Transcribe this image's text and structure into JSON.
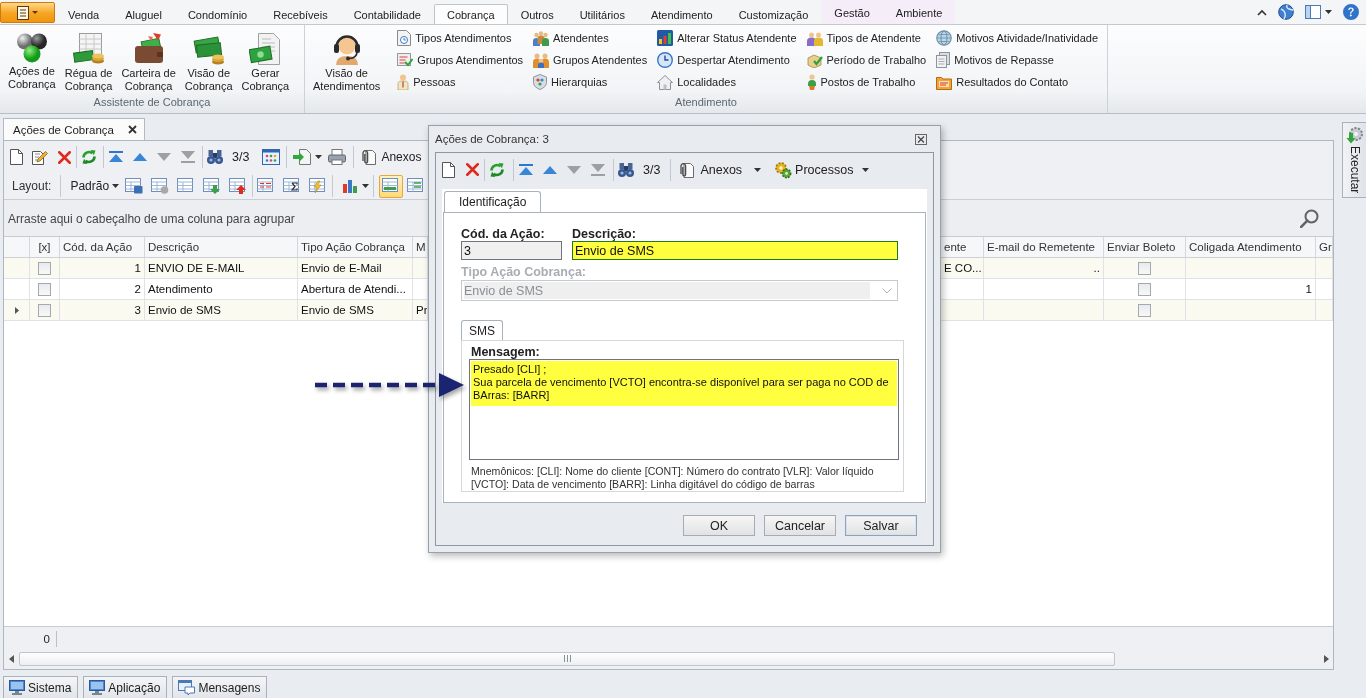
{
  "ribbon": {
    "tabs": [
      {
        "label": "Venda",
        "selected": false,
        "kind": "standard"
      },
      {
        "label": "Aluguel",
        "selected": false,
        "kind": "standard"
      },
      {
        "label": "Condomínio",
        "selected": false,
        "kind": "standard"
      },
      {
        "label": "Recebíveis",
        "selected": false,
        "kind": "standard"
      },
      {
        "label": "Contabilidade",
        "selected": false,
        "kind": "standard"
      },
      {
        "label": "Cobrança",
        "selected": true,
        "kind": "standard"
      },
      {
        "label": "Outros",
        "selected": false,
        "kind": "standard"
      },
      {
        "label": "Utilitários",
        "selected": false,
        "kind": "standard"
      },
      {
        "label": "Atendimento",
        "selected": false,
        "kind": "standard"
      },
      {
        "label": "Customização",
        "selected": false,
        "kind": "standard"
      },
      {
        "label": "Gestão",
        "selected": false,
        "kind": "contextual"
      },
      {
        "label": "Ambiente",
        "selected": false,
        "kind": "contextual"
      }
    ],
    "groups": [
      {
        "title": "Assistente de Cobrança",
        "large_buttons": [
          "Ações de\nCobrança",
          "Régua de\nCobrança",
          "Carteira de\nCobrança",
          "Visão de\nCobrança",
          "Gerar\nCobrança"
        ]
      },
      {
        "title": "Atendimento",
        "large_buttons": [
          "Visão de\nAtendimentos"
        ],
        "small_button_columns": [
          [
            "Tipos Atendimentos",
            "Grupos Atendimentos",
            "Pessoas"
          ],
          [
            "Atendentes",
            "Grupos Atendentes",
            "Hierarquias"
          ],
          [
            "Alterar Status Atendente",
            "Despertar Atendimento",
            "Localidades"
          ],
          [
            "Tipos de Atendente",
            "Período de Trabalho",
            "Postos de Trabalho"
          ],
          [
            "Motivos Atividade/Inatividade",
            "Motivos de Repasse",
            "Resultados do Contato"
          ]
        ]
      }
    ]
  },
  "document_tabs": [
    {
      "label": "Ações de Cobrança"
    }
  ],
  "toolbar": {
    "record_counter": "3/3",
    "attachments_label": "Anexos"
  },
  "layout_bar": {
    "label": "Layout:",
    "preset": "Padrão",
    "view_toggles": [
      {
        "selected": true
      },
      {
        "selected": false
      }
    ]
  },
  "group_panel": {
    "hint": "Arraste aqui o cabeçalho de uma coluna para agrupar"
  },
  "grid": {
    "columns": [
      "[x]",
      "Cód. da Ação",
      "Descrição",
      "Tipo Ação Cobrança",
      "M",
      "ente",
      "E-mail do Remetente",
      "Enviar Boleto",
      "Coligada Atendimento",
      "Gr"
    ],
    "rows": [
      {
        "current": false,
        "marked": false,
        "code": "1",
        "description": "ENVIO DE E-MAIL",
        "action_type": "Envio de E-Mail",
        "column_7": "E CO...",
        "sender_email": "..",
        "send_invoice": false
      },
      {
        "current": false,
        "marked": false,
        "code": "2",
        "description": "Atendimento",
        "action_type": "Abertura de Atendi...",
        "send_invoice": false,
        "affiliate": "1"
      },
      {
        "current": true,
        "marked": false,
        "code": "3",
        "description": "Envio de SMS",
        "action_type": "Envio de SMS",
        "column_6": "Pr",
        "send_invoice": false
      }
    ],
    "footer_count": "0"
  },
  "side_panel": {
    "label": "Executar"
  },
  "status_tabs": [
    "Sistema",
    "Aplicação",
    "Mensagens"
  ],
  "dialog": {
    "title": "Ações de Cobrança: 3",
    "toolbar": {
      "record_counter": "3/3",
      "attachments_label": "Anexos",
      "processes_label": "Processos"
    },
    "tabs": [
      {
        "label": "Identificação",
        "selected": true
      }
    ],
    "code": {
      "label": "Cód. da Ação:",
      "value": "3",
      "read_only": true
    },
    "description": {
      "label": "Descrição:",
      "value": "Envio de SMS",
      "highlighted": true
    },
    "action_type": {
      "label": "Tipo Ação Cobrança:",
      "value": "Envio de SMS",
      "disabled": true
    },
    "sub_tabs": [
      {
        "label": "SMS",
        "selected": true
      }
    ],
    "message": {
      "label": "Mensagem:",
      "lines": [
        "Presado [CLI] ;",
        "Sua parcela de vencimento [VCTO] encontra-se disponível para ser paga no COD de",
        "BArras: [BARR]"
      ],
      "highlighted": true
    },
    "mnemonics": [
      "Mnemônicos: [CLI]: Nome do cliente [CONT]: Número do contrato [VLR]: Valor líquido",
      "[VCTO]: Data de vencimento [BARR]: Linha digitável do código de barras"
    ],
    "buttons": [
      {
        "label": "OK",
        "focused": false
      },
      {
        "label": "Cancelar",
        "focused": false
      },
      {
        "label": "Salvar",
        "focused": true
      }
    ]
  }
}
